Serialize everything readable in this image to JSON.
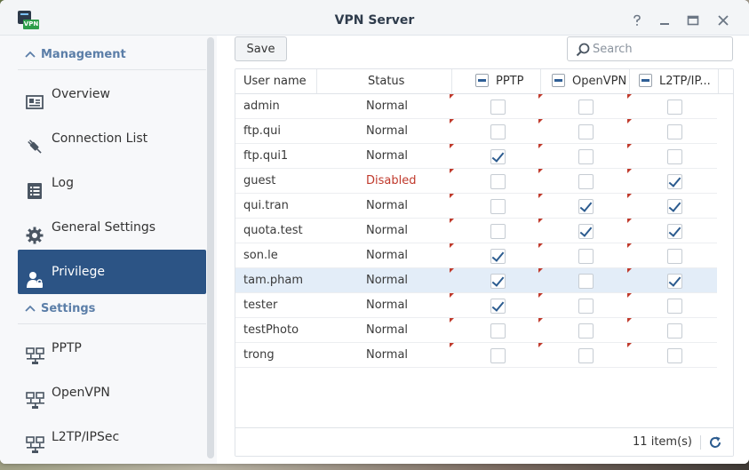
{
  "window": {
    "title": "VPN Server",
    "controls": [
      "help-icon",
      "minimize-icon",
      "maximize-icon",
      "close-icon"
    ],
    "app_badge": "VPN"
  },
  "sidebar": {
    "sections": [
      {
        "label": "Management",
        "icon": "chevron-up-icon"
      },
      {
        "label": "Settings",
        "icon": "chevron-up-icon"
      }
    ],
    "items": [
      {
        "label": "Overview",
        "icon": "overview-icon"
      },
      {
        "label": "Connection List",
        "icon": "plug-icon"
      },
      {
        "label": "Log",
        "icon": "log-icon"
      },
      {
        "label": "General Settings",
        "icon": "gear-icon"
      },
      {
        "label": "Privilege",
        "icon": "user-lock-icon",
        "active": true
      },
      {
        "label": "PPTP",
        "icon": "network-icon"
      },
      {
        "label": "OpenVPN",
        "icon": "network-icon"
      },
      {
        "label": "L2TP/IPSec",
        "icon": "network-icon"
      }
    ]
  },
  "toolbar": {
    "save_label": "Save",
    "search_placeholder": "Search"
  },
  "table": {
    "columns": [
      "User name",
      "Status",
      "PPTP",
      "OpenVPN",
      "L2TP/IP..."
    ],
    "rows": [
      {
        "user": "admin",
        "status": "Normal",
        "pptp": false,
        "openvpn": false,
        "l2tp": false
      },
      {
        "user": "ftp.qui",
        "status": "Normal",
        "pptp": false,
        "openvpn": false,
        "l2tp": false
      },
      {
        "user": "ftp.qui1",
        "status": "Normal",
        "pptp": true,
        "openvpn": false,
        "l2tp": false
      },
      {
        "user": "guest",
        "status": "Disabled",
        "pptp": false,
        "openvpn": false,
        "l2tp": true
      },
      {
        "user": "qui.tran",
        "status": "Normal",
        "pptp": false,
        "openvpn": true,
        "l2tp": true
      },
      {
        "user": "quota.test",
        "status": "Normal",
        "pptp": false,
        "openvpn": true,
        "l2tp": true
      },
      {
        "user": "son.le",
        "status": "Normal",
        "pptp": true,
        "openvpn": false,
        "l2tp": false
      },
      {
        "user": "tam.pham",
        "status": "Normal",
        "pptp": true,
        "openvpn": false,
        "l2tp": true,
        "selected": true
      },
      {
        "user": "tester",
        "status": "Normal",
        "pptp": true,
        "openvpn": false,
        "l2tp": false
      },
      {
        "user": "testPhoto",
        "status": "Normal",
        "pptp": false,
        "openvpn": false,
        "l2tp": false
      },
      {
        "user": "trong",
        "status": "Normal",
        "pptp": false,
        "openvpn": false,
        "l2tp": false
      }
    ],
    "footer": {
      "count_label": "11 item(s)",
      "refresh_icon": "refresh-icon"
    }
  },
  "colors": {
    "accent": "#2c5485",
    "section_header": "#5b7ea8",
    "disabled_status": "#c0392b",
    "check": "#2b5b8f",
    "selected_row": "#e3edf8"
  }
}
